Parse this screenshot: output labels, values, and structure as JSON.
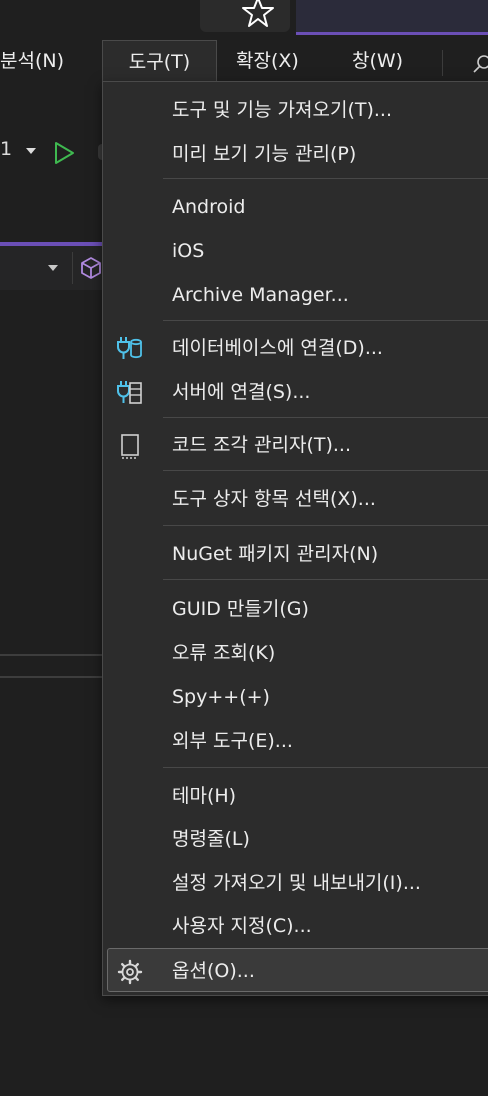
{
  "menubar": {
    "items": [
      {
        "label": "분석(N)"
      },
      {
        "label": "도구(T)"
      },
      {
        "label": "확장(X)"
      },
      {
        "label": "창(W)"
      }
    ]
  },
  "toolbar": {
    "config_number": "1"
  },
  "tools_menu": {
    "items": [
      {
        "label": "도구 및 기능 가져오기(T)..."
      },
      {
        "label": "미리 보기 기능 관리(P)"
      },
      {
        "label": "Android"
      },
      {
        "label": "iOS"
      },
      {
        "label": "Archive Manager..."
      },
      {
        "label": "데이터베이스에 연결(D)...",
        "icon": "database-connect-icon"
      },
      {
        "label": "서버에 연결(S)...",
        "icon": "server-connect-icon"
      },
      {
        "label": "코드 조각 관리자(T)...",
        "icon": "code-snippet-icon"
      },
      {
        "label": "도구 상자 항목 선택(X)..."
      },
      {
        "label": "NuGet 패키지 관리자(N)"
      },
      {
        "label": "GUID 만들기(G)"
      },
      {
        "label": "오류 조회(K)"
      },
      {
        "label": "Spy++(+)"
      },
      {
        "label": "외부 도구(E)..."
      },
      {
        "label": "테마(H)"
      },
      {
        "label": "명령줄(L)"
      },
      {
        "label": "설정 가져오기 및 내보내기(I)..."
      },
      {
        "label": "사용자 지정(C)..."
      },
      {
        "label": "옵션(O)...",
        "icon": "gear-icon"
      }
    ]
  },
  "colors": {
    "accent": "#6b4fb6",
    "menu_bg": "#2c2c2c",
    "icon_blue": "#4fc1e9",
    "run_green": "#3fb950"
  }
}
